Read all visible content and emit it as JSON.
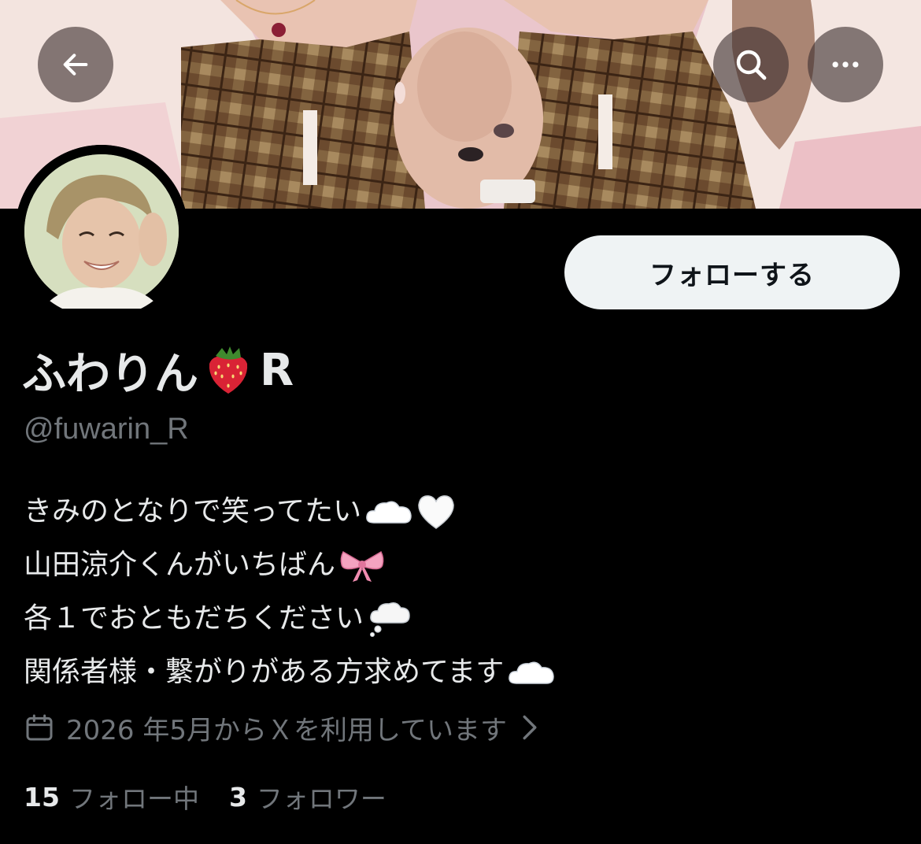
{
  "profile": {
    "display_name": "ふわりん",
    "display_name_suffix": "R",
    "handle": "@fuwarin_R",
    "bio_lines": [
      "きみのとなりで笑ってたい",
      "山田涼介くんがいちばん",
      "各１でおともだちください",
      "関係者様・繋がりがある方求めてます"
    ],
    "joined": "2026 年5月からＸを利用しています",
    "following_count": "15",
    "following_label": "フォロー中",
    "followers_count": "3",
    "followers_label": "フォロワー"
  },
  "actions": {
    "follow_label": "フォローする"
  },
  "icons": {
    "back": "arrow-left-icon",
    "search": "search-icon",
    "more": "more-horizontal-icon",
    "calendar": "calendar-icon",
    "chevron": "chevron-right-icon",
    "name_emoji": "strawberry-emoji",
    "bio_emojis": [
      "cloud-emoji",
      "white-heart-emoji",
      "ribbon-emoji",
      "thought-balloon-emoji",
      "cloud-emoji"
    ]
  },
  "colors": {
    "background": "#000000",
    "text_primary": "#e7e9ea",
    "text_secondary": "#71767b",
    "follow_button_bg": "#eff3f4",
    "follow_button_text": "#0f1419"
  }
}
